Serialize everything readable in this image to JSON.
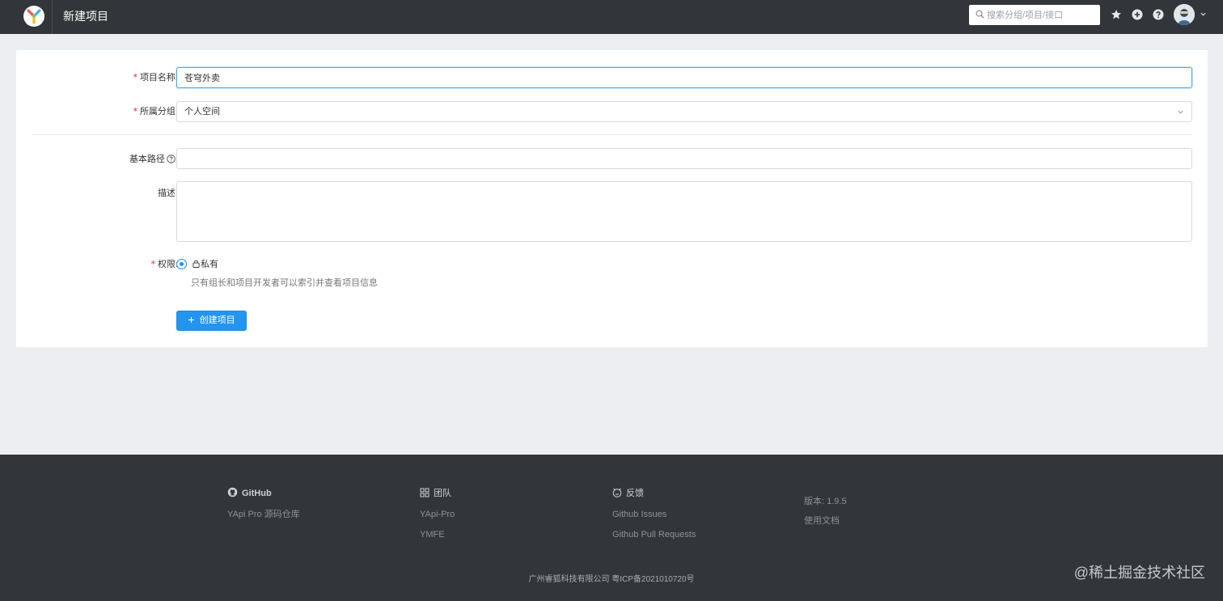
{
  "header": {
    "title": "新建项目",
    "search_placeholder": "搜索分组/项目/接口"
  },
  "form": {
    "name": {
      "label": "项目名称",
      "value": "苍穹外卖",
      "required": true
    },
    "group": {
      "label": "所属分组",
      "value": "个人空间",
      "required": true
    },
    "basepath": {
      "label": "基本路径",
      "value": ""
    },
    "desc": {
      "label": "描述",
      "value": ""
    },
    "permission": {
      "label": "权限",
      "option": "私有",
      "hint": "只有组长和项目开发者可以索引并查看项目信息",
      "required": true
    },
    "submit_label": "创建项目"
  },
  "footer": {
    "github": {
      "title": "GitHub",
      "links": [
        "YApi Pro 源码仓库"
      ]
    },
    "team": {
      "title": "团队",
      "links": [
        "YApi-Pro",
        "YMFE"
      ]
    },
    "feedback": {
      "title": "反馈",
      "links": [
        "Github Issues",
        "Github Pull Requests"
      ]
    },
    "info": {
      "version": "版本: 1.9.5",
      "docs": "使用文档"
    },
    "copyright": "广州睿狐科技有限公司 粤ICP备2021010720号",
    "watermark": "@稀土掘金技术社区"
  },
  "colors": {
    "header_bg": "#32363a",
    "primary": "#2395f1",
    "required": "#f5222d"
  },
  "icons": [
    "yapi-logo-icon",
    "search-icon",
    "star-icon",
    "plus-circle-icon",
    "question-circle-icon",
    "user-avatar",
    "caret-down-icon",
    "help-icon",
    "lock-icon",
    "github-icon",
    "team-icon",
    "feedback-icon"
  ]
}
